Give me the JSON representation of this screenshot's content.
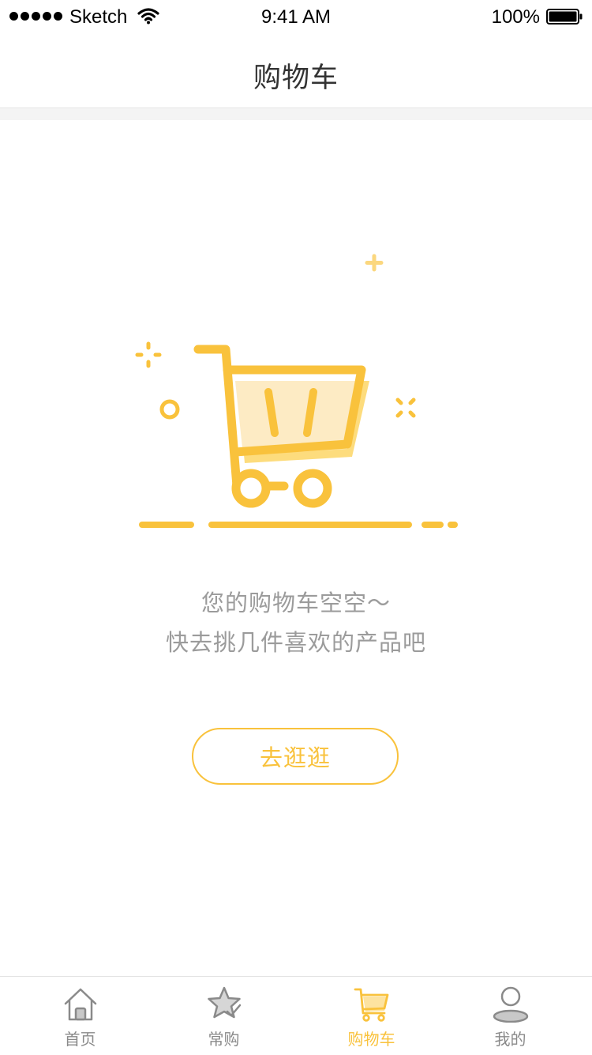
{
  "status_bar": {
    "carrier": "Sketch",
    "time": "9:41 AM",
    "battery": "100%"
  },
  "nav": {
    "title": "购物车"
  },
  "empty_state": {
    "line1": "您的购物车空空～",
    "line2": "快去挑几件喜欢的产品吧",
    "button_label": "去逛逛"
  },
  "tab_bar": {
    "items": [
      {
        "label": "首页",
        "icon": "home-icon",
        "active": false
      },
      {
        "label": "常购",
        "icon": "star-icon",
        "active": false
      },
      {
        "label": "购物车",
        "icon": "cart-icon",
        "active": true
      },
      {
        "label": "我的",
        "icon": "profile-icon",
        "active": false
      }
    ]
  },
  "colors": {
    "accent": "#f9c23c",
    "accent_light": "#fdebc4",
    "text_muted": "#9b9b9b",
    "tab_inactive": "#8a8a8a"
  }
}
